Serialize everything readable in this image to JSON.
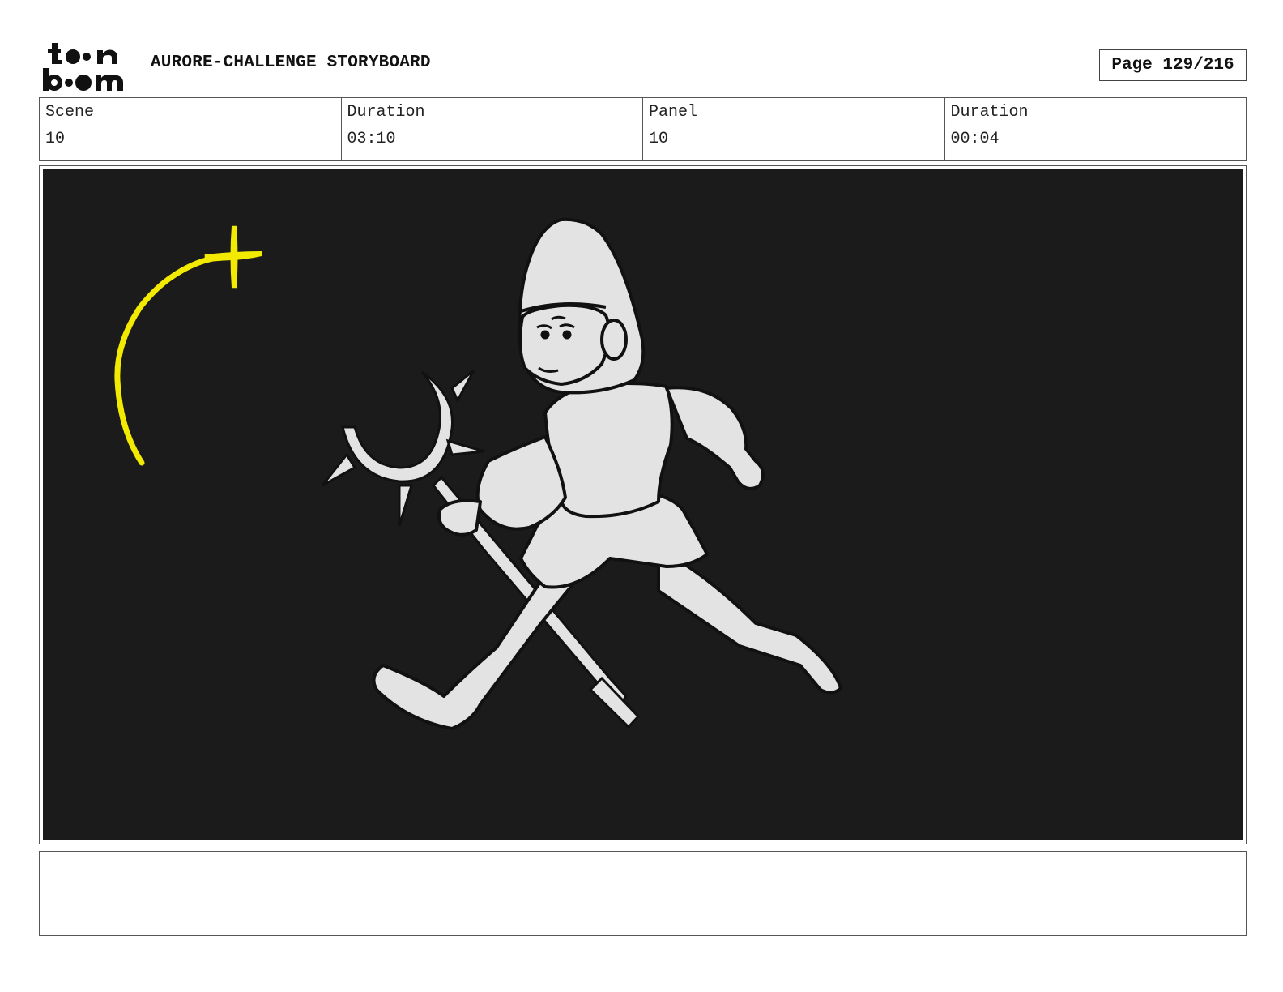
{
  "header": {
    "logo_text": "toon boom",
    "title": "AURORE-CHALLENGE STORYBOARD",
    "page_label": "Page 129/216"
  },
  "info": {
    "scene_label": "Scene",
    "scene_value": "10",
    "scene_duration_label": "Duration",
    "scene_duration_value": "03:10",
    "panel_label": "Panel",
    "panel_value": "10",
    "panel_duration_label": "Duration",
    "panel_duration_value": "00:04"
  },
  "panel": {
    "background_color": "#1b1b1b",
    "sparkle_color": "#f2ea00",
    "figure_fill": "#e3e3e3"
  },
  "notes": {
    "text": ""
  }
}
